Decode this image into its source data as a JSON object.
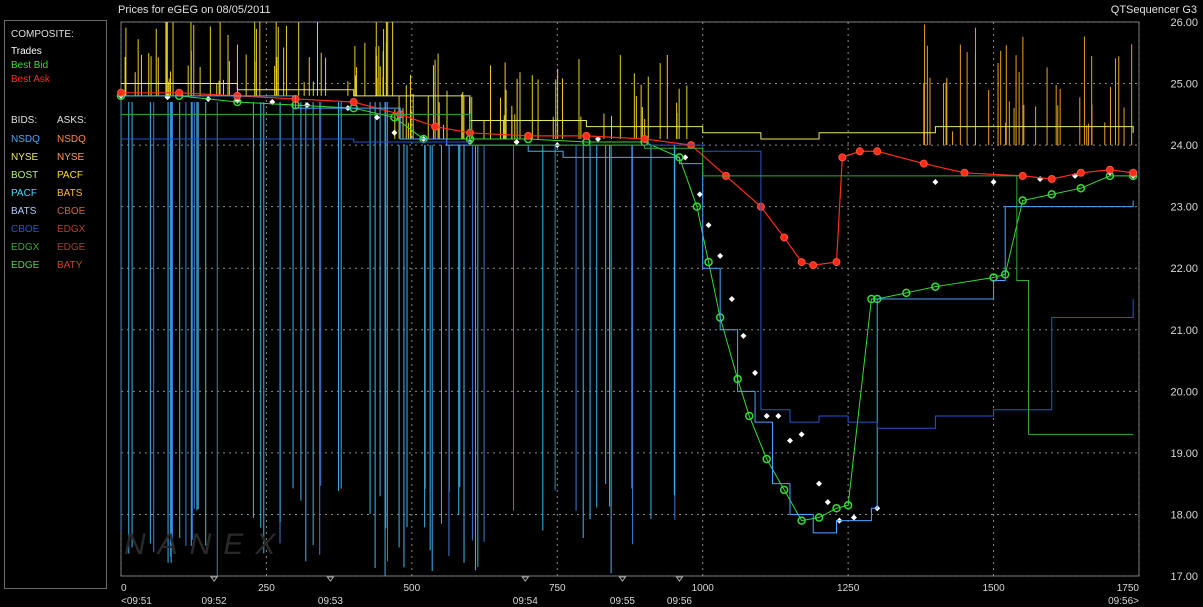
{
  "header": {
    "title": "Prices for  eGEG  on  08/05/2011",
    "app": "QTSequencer G3"
  },
  "legend": {
    "composite_label": "COMPOSITE:",
    "composite": [
      {
        "label": "Trades",
        "color": "#ffffff"
      },
      {
        "label": "Best Bid",
        "color": "#33dd33"
      },
      {
        "label": "Best Ask",
        "color": "#ff2a1a"
      }
    ],
    "bids_label": "BIDS:",
    "asks_label": "ASKS:",
    "bids": [
      {
        "label": "NSDQ",
        "color": "#4aa6ff"
      },
      {
        "label": "NYSE",
        "color": "#e8e860"
      },
      {
        "label": "BOST",
        "color": "#b6f070"
      },
      {
        "label": "PACF",
        "color": "#44ddff"
      },
      {
        "label": "BATS",
        "color": "#aaccff"
      },
      {
        "label": "CBOE",
        "color": "#2255cc"
      },
      {
        "label": "EDGX",
        "color": "#33aa33"
      },
      {
        "label": "EDGE",
        "color": "#55cc55"
      }
    ],
    "asks": [
      {
        "label": "NSDQ",
        "color": "#ff8844"
      },
      {
        "label": "NYSE",
        "color": "#ff9966"
      },
      {
        "label": "PACF",
        "color": "#ffdd22"
      },
      {
        "label": "BATS",
        "color": "#ffbb33"
      },
      {
        "label": "CBOE",
        "color": "#cc6633"
      },
      {
        "label": "EDGX",
        "color": "#aa4422"
      },
      {
        "label": "EDGE",
        "color": "#994433"
      },
      {
        "label": "BATY",
        "color": "#cc4422"
      }
    ]
  },
  "watermark": "NANEX",
  "chart_data": {
    "type": "line",
    "title": "Prices for  eGEG  on  08/05/2011",
    "ylim": [
      17.0,
      26.0
    ],
    "xlim": [
      0,
      1750
    ],
    "y_ticks": [
      "26.00",
      "25.00",
      "24.00",
      "23.00",
      "22.00",
      "21.00",
      "20.00",
      "19.00",
      "18.00",
      "17.00"
    ],
    "x_ticks": [
      {
        "x": 0,
        "label": "0"
      },
      {
        "x": 250,
        "label": "250"
      },
      {
        "x": 500,
        "label": "500"
      },
      {
        "x": 750,
        "label": "750"
      },
      {
        "x": 1000,
        "label": "1000"
      },
      {
        "x": 1250,
        "label": "1250"
      },
      {
        "x": 1500,
        "label": "1500"
      },
      {
        "x": 1750,
        "label": "1750"
      }
    ],
    "time_ticks": [
      {
        "x": 0,
        "label": "<09:51"
      },
      {
        "x": 160,
        "label": "09:52"
      },
      {
        "x": 360,
        "label": "09:53"
      },
      {
        "x": 695,
        "label": "09:54"
      },
      {
        "x": 862,
        "label": "09:55"
      },
      {
        "x": 960,
        "label": "09:56"
      },
      {
        "x": 1750,
        "label": "09:56>"
      }
    ],
    "grid": true,
    "series": [
      {
        "name": "Trades",
        "color": "#ffffff",
        "kind": "trades",
        "x": [
          0,
          80,
          150,
          200,
          260,
          320,
          390,
          440,
          470,
          520,
          600,
          680,
          750,
          820,
          900,
          970,
          995,
          1010,
          1030,
          1050,
          1070,
          1090,
          1110,
          1130,
          1150,
          1170,
          1200,
          1215,
          1235,
          1260,
          1300,
          1400,
          1500,
          1580,
          1640,
          1700,
          1740
        ],
        "y": [
          24.8,
          24.78,
          24.75,
          24.72,
          24.7,
          24.65,
          24.6,
          24.45,
          24.2,
          24.1,
          24.05,
          24.05,
          24.0,
          24.1,
          24.1,
          23.8,
          23.2,
          22.7,
          22.2,
          21.5,
          20.9,
          20.3,
          19.6,
          19.6,
          19.2,
          19.3,
          18.5,
          18.2,
          17.9,
          17.95,
          18.1,
          23.4,
          23.4,
          23.45,
          23.5,
          23.55,
          23.5
        ]
      },
      {
        "name": "Best Bid",
        "color": "#33dd33",
        "kind": "bid",
        "x": [
          0,
          100,
          200,
          300,
          400,
          470,
          520,
          600,
          700,
          800,
          900,
          960,
          990,
          1010,
          1030,
          1060,
          1080,
          1110,
          1140,
          1170,
          1200,
          1230,
          1250,
          1290,
          1300,
          1350,
          1400,
          1500,
          1520,
          1550,
          1600,
          1650,
          1700,
          1740
        ],
        "y": [
          24.8,
          24.8,
          24.7,
          24.65,
          24.6,
          24.45,
          24.1,
          24.1,
          24.1,
          24.05,
          24.05,
          23.8,
          23.0,
          22.1,
          21.2,
          20.2,
          19.6,
          18.9,
          18.4,
          17.9,
          17.95,
          18.1,
          18.15,
          21.5,
          21.5,
          21.6,
          21.7,
          21.85,
          21.9,
          23.1,
          23.2,
          23.3,
          23.5,
          23.5
        ]
      },
      {
        "name": "Best Ask",
        "color": "#ff2a1a",
        "kind": "ask",
        "x": [
          0,
          100,
          200,
          300,
          400,
          480,
          540,
          600,
          700,
          800,
          900,
          980,
          1040,
          1100,
          1140,
          1170,
          1190,
          1230,
          1240,
          1270,
          1300,
          1380,
          1450,
          1550,
          1600,
          1650,
          1700,
          1740
        ],
        "y": [
          24.85,
          24.85,
          24.8,
          24.75,
          24.7,
          24.5,
          24.3,
          24.2,
          24.15,
          24.15,
          24.1,
          24.0,
          23.5,
          23.0,
          22.5,
          22.1,
          22.05,
          22.1,
          23.8,
          23.9,
          23.9,
          23.7,
          23.55,
          23.5,
          23.45,
          23.55,
          23.6,
          23.55
        ]
      },
      {
        "name": "NSDQ",
        "color": "#4aa6ff",
        "kind": "bidline",
        "x": [
          0,
          300,
          480,
          560,
          700,
          760,
          960,
          1000,
          1030,
          1060,
          1090,
          1120,
          1150,
          1190,
          1230,
          1290,
          1300,
          1500,
          1520,
          1740
        ],
        "y": [
          24.8,
          24.6,
          24.1,
          24.0,
          23.9,
          23.8,
          23.7,
          22.0,
          21.0,
          20.0,
          19.5,
          18.5,
          18.0,
          17.7,
          17.9,
          18.1,
          21.5,
          21.8,
          23.0,
          23.1
        ]
      },
      {
        "name": "NYSE",
        "color": "#e8e860",
        "kind": "askline",
        "x": [
          0,
          200,
          400,
          600,
          800,
          1000,
          1100,
          1200,
          1400,
          1600,
          1740
        ],
        "y": [
          25.0,
          24.9,
          24.8,
          24.4,
          24.3,
          24.2,
          24.1,
          24.2,
          24.3,
          24.3,
          24.2
        ]
      },
      {
        "name": "CBOE",
        "color": "#2255cc",
        "kind": "bidline",
        "x": [
          0,
          200,
          400,
          600,
          800,
          1000,
          1100,
          1150,
          1200,
          1250,
          1300,
          1400,
          1500,
          1600,
          1740
        ],
        "y": [
          24.1,
          24.1,
          24.05,
          24.0,
          24.0,
          23.9,
          19.7,
          19.5,
          19.6,
          19.5,
          19.4,
          19.6,
          19.7,
          21.2,
          21.5
        ]
      },
      {
        "name": "EDGX",
        "color": "#33aa33",
        "kind": "bidline",
        "x": [
          0,
          400,
          600,
          900,
          1000,
          1200,
          1300,
          1500,
          1540,
          1560,
          1740
        ],
        "y": [
          24.5,
          24.5,
          24.0,
          23.95,
          23.5,
          23.5,
          23.5,
          23.5,
          21.8,
          19.3,
          19.3
        ]
      }
    ]
  }
}
